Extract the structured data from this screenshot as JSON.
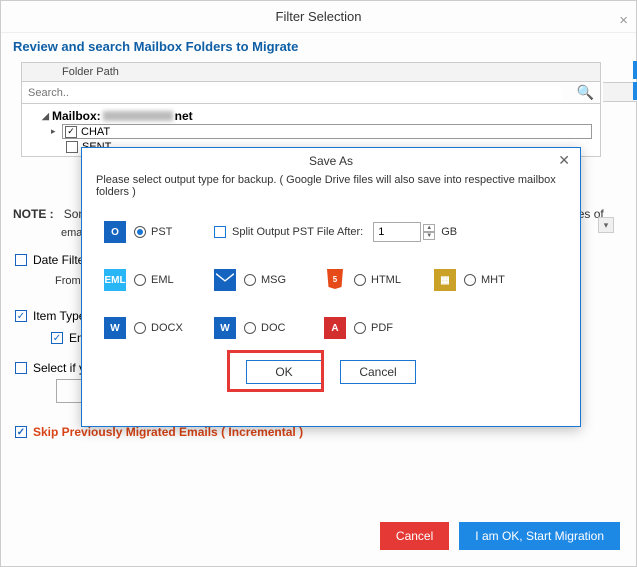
{
  "window": {
    "title": "Filter Selection",
    "subtitle": "Review and search Mailbox Folders to Migrate"
  },
  "tree": {
    "folder_path_header": "Folder Path",
    "search_placeholder": "Search..",
    "mailbox_label": "Mailbox: ",
    "mailbox_suffix": "net",
    "items": [
      {
        "label": "CHAT",
        "checked": true
      },
      {
        "label": "SENT",
        "checked": false
      }
    ]
  },
  "bg": {
    "note_prefix": "NOTE :",
    "note_text_left": "Som",
    "note_text_right": "ies of",
    "note_line2": "ema",
    "date_filter": "Date Filter",
    "from_label": "From",
    "item_type": "Item Type",
    "en_label": "En",
    "select_if": "Select if yo",
    "skip": "Skip Previously Migrated Emails ( Incremental )",
    "cancel": "Cancel",
    "start": "I am OK, Start Migration"
  },
  "modal": {
    "title": "Save As",
    "hint": "Please select output type for backup. ( Google Drive files will also save into respective mailbox folders )",
    "split_label": "Split Output PST File After:",
    "split_value": "1",
    "split_unit": "GB",
    "formats": {
      "pst": "PST",
      "eml": "EML",
      "msg": "MSG",
      "html": "HTML",
      "mht": "MHT",
      "docx": "DOCX",
      "doc": "DOC",
      "pdf": "PDF"
    },
    "ok": "OK",
    "cancel": "Cancel"
  }
}
